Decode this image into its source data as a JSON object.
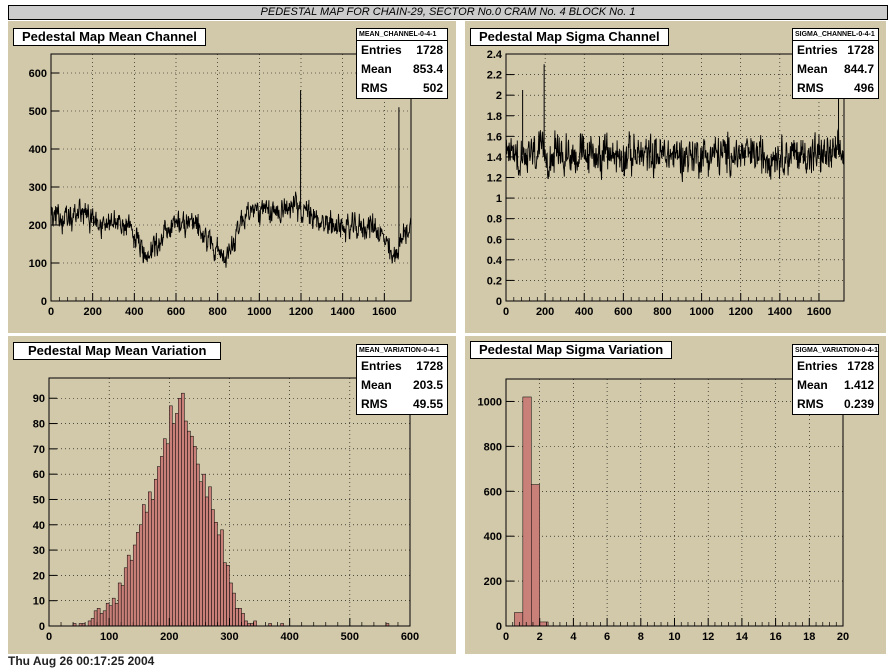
{
  "banner": "PEDESTAL MAP FOR CHAIN-29, SECTOR No.0 CRAM No. 4 BLOCK No. 1",
  "footer_text": "Thu Aug 26 00:17:25 2004",
  "colors": {
    "pad": "#d2c8aa",
    "fill": "#c88078",
    "grid": "#000000"
  },
  "chart_data": [
    {
      "type": "line",
      "title": "Pedestal Map Mean Channel",
      "stats": {
        "name": "MEAN_CHANNEL-0-4-1",
        "entries": "1728",
        "mean": "853.4",
        "rms": "502"
      },
      "stats_labels": {
        "entries": "Entries",
        "mean": "Mean",
        "rms": "RMS"
      },
      "xlim": [
        0,
        1728
      ],
      "ylim": [
        0,
        650
      ],
      "xticks": [
        0,
        200,
        400,
        600,
        800,
        1000,
        1200,
        1400,
        1600
      ],
      "yticks": [
        0,
        100,
        200,
        300,
        400,
        500,
        600
      ],
      "grid": true,
      "series_profile": {
        "x": [
          0,
          80,
          150,
          220,
          300,
          400,
          440,
          520,
          600,
          700,
          780,
          840,
          900,
          950,
          1050,
          1150,
          1200,
          1260,
          1350,
          1450,
          1550,
          1600,
          1640,
          1700,
          1728
        ],
        "y": [
          230,
          210,
          240,
          200,
          210,
          180,
          120,
          160,
          210,
          200,
          150,
          100,
          200,
          240,
          230,
          250,
          240,
          220,
          200,
          190,
          200,
          160,
          110,
          180,
          200
        ]
      },
      "noise_amplitude": 40,
      "spikes": [
        {
          "x": 1198,
          "y": 555
        },
        {
          "x": 1670,
          "y": 510
        }
      ]
    },
    {
      "type": "line",
      "title": "Pedestal Map Sigma Channel",
      "stats": {
        "name": "SIGMA_CHANNEL-0-4-1",
        "entries": "1728",
        "mean": "844.7",
        "rms": "496"
      },
      "stats_labels": {
        "entries": "Entries",
        "mean": "Mean",
        "rms": "RMS"
      },
      "xlim": [
        0,
        1728
      ],
      "ylim": [
        0,
        2.4
      ],
      "xticks": [
        0,
        200,
        400,
        600,
        800,
        1000,
        1200,
        1400,
        1600
      ],
      "yticks": [
        0,
        0.2,
        0.4,
        0.6,
        0.8,
        1,
        1.2,
        1.4,
        1.6,
        1.8,
        2,
        2.2,
        2.4
      ],
      "grid": true,
      "series_profile": {
        "x": [
          0,
          1728
        ],
        "y": [
          1.42,
          1.42
        ]
      },
      "noise_amplitude": 0.22,
      "spikes": [
        {
          "x": 195,
          "y": 2.3
        },
        {
          "x": 85,
          "y": 2.05
        },
        {
          "x": 1700,
          "y": 2.05
        }
      ]
    },
    {
      "type": "histogram",
      "title": "Pedestal Map Mean Variation",
      "stats": {
        "name": "MEAN_VARIATION-0-4-1",
        "entries": "1728",
        "mean": "203.5",
        "rms": "49.55"
      },
      "stats_labels": {
        "entries": "Entries",
        "mean": "Mean",
        "rms": "RMS"
      },
      "xlim": [
        0,
        600
      ],
      "ylim": [
        0,
        98
      ],
      "xticks": [
        0,
        100,
        200,
        300,
        400,
        500,
        600
      ],
      "yticks": [
        0,
        10,
        20,
        30,
        40,
        50,
        60,
        70,
        80,
        90
      ],
      "grid": true,
      "bin_width": 5,
      "bin_start": 40,
      "values": [
        1,
        0,
        1,
        1,
        0,
        2,
        3,
        6,
        7,
        5,
        6,
        9,
        8,
        11,
        9,
        17,
        16,
        23,
        28,
        26,
        32,
        37,
        40,
        48,
        45,
        53,
        50,
        58,
        63,
        67,
        74,
        72,
        87,
        80,
        84,
        90,
        92,
        81,
        77,
        75,
        71,
        64,
        57,
        60,
        51,
        55,
        46,
        41,
        36,
        38,
        25,
        24,
        17,
        13,
        7,
        7,
        5,
        2,
        1,
        1,
        2,
        0,
        0,
        0,
        0,
        1,
        0,
        0,
        0,
        1
      ],
      "extra_bins": [
        {
          "x": 560,
          "v": 1
        }
      ]
    },
    {
      "type": "histogram",
      "title": "Pedestal Map Sigma Variation",
      "stats": {
        "name": "SIGMA_VARIATION-0-4-1",
        "entries": "1728",
        "mean": "1.412",
        "rms": "0.239"
      },
      "stats_labels": {
        "entries": "Entries",
        "mean": "Mean",
        "rms": "RMS"
      },
      "xlim": [
        0,
        20
      ],
      "ylim": [
        0,
        1100
      ],
      "xticks": [
        0,
        2,
        4,
        6,
        8,
        10,
        12,
        14,
        16,
        18,
        20
      ],
      "yticks": [
        0,
        200,
        400,
        600,
        800,
        1000
      ],
      "grid": true,
      "bin_width": 0.5,
      "bin_start": 0.5,
      "values": [
        60,
        1020,
        630,
        18
      ]
    }
  ]
}
